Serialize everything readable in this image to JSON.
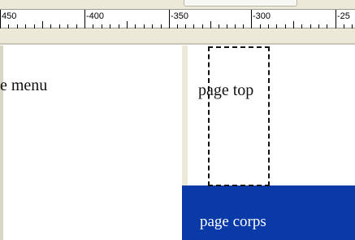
{
  "ruler": {
    "labels": [
      "450",
      "-400",
      "-350",
      "-300",
      "-25"
    ]
  },
  "canvas": {
    "left_text": "e menu",
    "right_text": "page top",
    "block_text": "page corps"
  },
  "colors": {
    "block": "#0a3aa8",
    "chrome": "#ece9d8"
  }
}
